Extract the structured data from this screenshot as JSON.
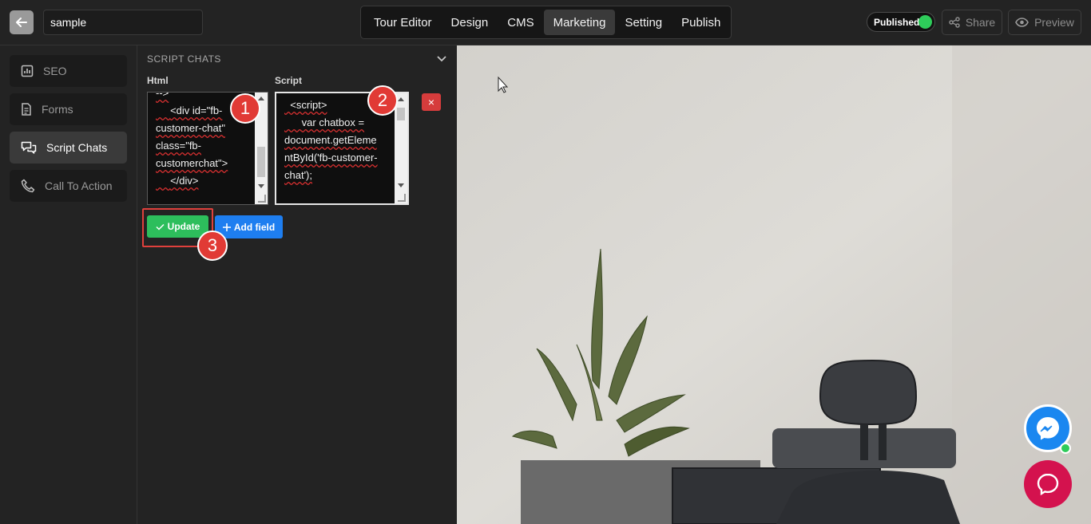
{
  "header": {
    "title_value": "sample",
    "nav_tabs": [
      {
        "label": "Tour Editor"
      },
      {
        "label": "Design"
      },
      {
        "label": "CMS"
      },
      {
        "label": "Marketing",
        "active": true
      },
      {
        "label": "Setting"
      },
      {
        "label": "Publish"
      }
    ],
    "published_label": "Published",
    "share_label": "Share",
    "preview_label": "Preview"
  },
  "sidebar": {
    "items": [
      {
        "label": "SEO",
        "icon": "chart-icon"
      },
      {
        "label": "Forms",
        "icon": "document-icon"
      },
      {
        "label": "Script Chats",
        "icon": "chat-bubbles-icon",
        "active": true
      },
      {
        "label": "Call To Action",
        "icon": "phone-icon"
      }
    ]
  },
  "panel": {
    "section_title": "SCRIPT CHATS",
    "html_label": "Html",
    "script_label": "Script",
    "html_value": "-->\n     <div id=\"fb-\ncustomer-chat\"\nclass=\"fb-\ncustomerchat\">\n     </div>",
    "script_value": "  <script>\n      var chatbox =\ndocument.getEleme\nntById('fb-customer-\nchat');",
    "update_label": "Update",
    "add_field_label": "Add field",
    "delete_label": "×"
  },
  "annotations": [
    "1",
    "2",
    "3"
  ],
  "colors": {
    "accent_green": "#2dbe5c",
    "accent_blue": "#1e7ef0",
    "danger": "#d63c3c",
    "messenger": "#1a87f0",
    "chat": "#d4124e"
  }
}
